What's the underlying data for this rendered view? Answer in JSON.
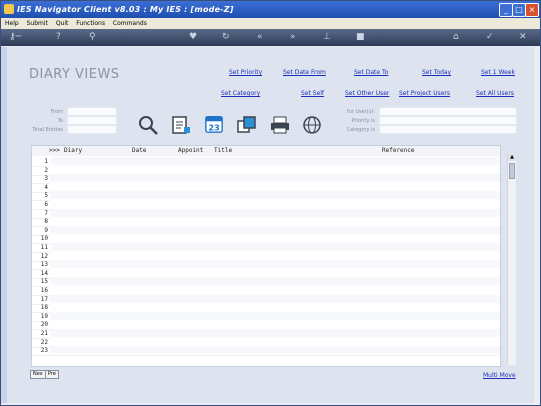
{
  "window": {
    "title": "IES Navigator Client v8.03 : My IES :      [mode-Z]"
  },
  "menu": [
    "Help",
    "Submit",
    "Quit",
    "Functions",
    "Commands"
  ],
  "toolbar_icons": [
    "key-icon",
    "help-icon",
    "search-icon",
    "heart-icon",
    "refresh-icon",
    "back-icon",
    "forward-icon",
    "pin-icon",
    "stop-icon",
    "home-icon",
    "check-icon",
    "close-icon"
  ],
  "page": {
    "heading": "DIARY VIEWS"
  },
  "links": {
    "set_priority": "Set Priority",
    "set_date_from": "Set Date From",
    "set_date_to": "Set Date To",
    "set_today": "Set Today",
    "set_1_week": "Set 1 Week",
    "set_category": "Set Category",
    "set_self": "Set Self",
    "set_other_user": "Set Other User",
    "set_project_users": "Set Project Users",
    "set_all_users": "Set All Users"
  },
  "filters_left": {
    "from": "From",
    "to": "To",
    "total_entries": "Total Entries"
  },
  "filters_right": {
    "for_users": "for User(s):",
    "priority": "Priority is",
    "category": "Category is"
  },
  "actions": [
    "search-icon",
    "edit-document-icon",
    "calendar-icon",
    "copy-windows-icon",
    "printer-icon",
    "globe-icon"
  ],
  "calendar_day": "23",
  "grid": {
    "headers": [
      ">>>",
      "Diary",
      "Date",
      "Appoint",
      "Title",
      "Reference"
    ],
    "rows": [
      "1",
      "2",
      "3",
      "4",
      "5",
      "6",
      "7",
      "8",
      "9",
      "10",
      "11",
      "12",
      "13",
      "14",
      "15",
      "16",
      "17",
      "18",
      "19",
      "20",
      "21",
      "22",
      "23"
    ]
  },
  "footer": {
    "nex": "Nex",
    "pre": "Pre",
    "multi_move": "Multi Move"
  }
}
